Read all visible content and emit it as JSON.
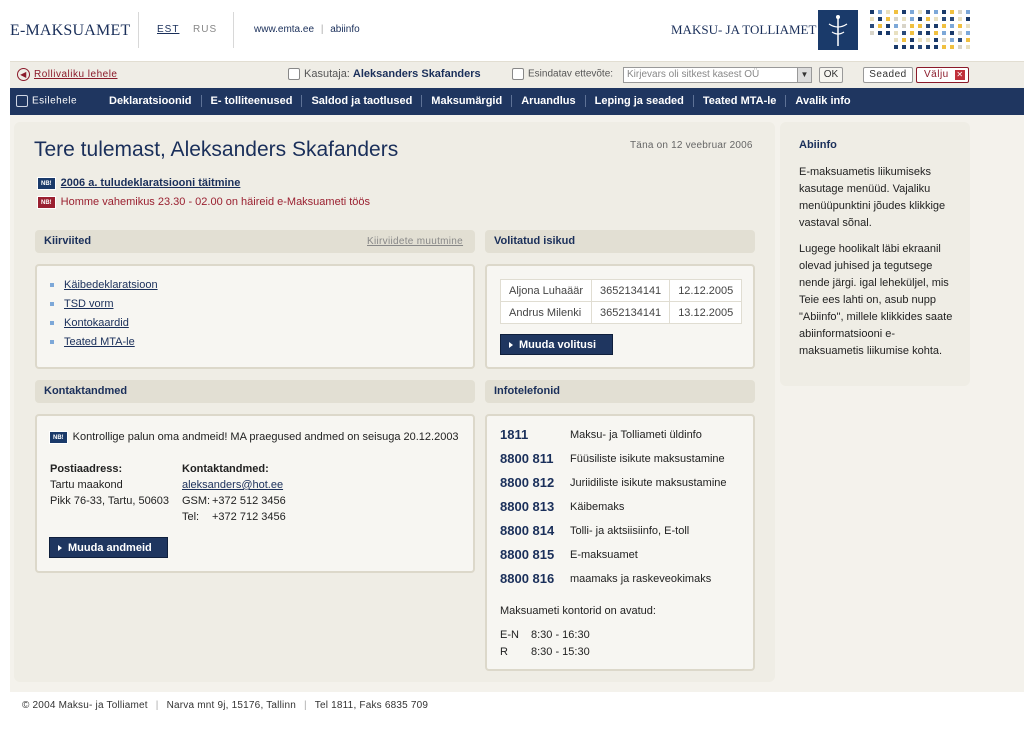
{
  "header": {
    "logo_left": "E-MAKSUAMET",
    "lang_est": "EST",
    "lang_rus": "RUS",
    "link_site": "www.emta.ee",
    "link_sep": "|",
    "link_help": "abiinfo",
    "logo_right": "MAKSU- JA TOLLIAMET"
  },
  "toolbar": {
    "back_label": "Rollivaliku lehele",
    "user_label": "Kasutaja:",
    "user_name": "Aleksanders Skafanders",
    "firm_label": "Esindatav ettevõte:",
    "firm_placeholder": "Kirjevars oli sitkest kasest OÜ",
    "ok_label": "OK",
    "settings_label": "Seaded",
    "logout_label": "Välju"
  },
  "nav": {
    "home": "Esilehele",
    "items": [
      "Deklaratsioonid",
      "E- tolliteenused",
      "Saldod ja taotlused",
      "Maksumärgid",
      "Aruandlus",
      "Leping ja seaded",
      "Teated MTA-le",
      "Avalik info"
    ]
  },
  "main": {
    "welcome": "Tere tulemast, Aleksanders Skafanders",
    "today": "Täna on 12 veebruar 2006",
    "nb": "NB!",
    "notice1": "2006 a. tuludeklaratsiooni täitmine",
    "notice2": "Homme vahemikus 23.30 - 02.00 on häireid e-Maksuameti töös"
  },
  "quicklinks": {
    "title": "Kiirviited",
    "change": "Kiirviidete muutmine",
    "items": [
      "Käibedeklaratsioon",
      "TSD vorm",
      "Kontokaardid",
      "Teated MTA-le"
    ]
  },
  "authorized": {
    "title": "Volitatud isikud",
    "rows": [
      [
        "Aljona Luhaäär",
        "3652134141",
        "12.12.2005"
      ],
      [
        "Andrus Milenki",
        "3652134141",
        "13.12.2005"
      ]
    ],
    "button": "Muuda volitusi"
  },
  "contact": {
    "title": "Kontaktandmed",
    "notice": "Kontrollige palun oma andmeid! MA praegused andmed on seisuga 20.12.2003",
    "postal_label": "Postiaadress:",
    "postal_line1": "Tartu maakond",
    "postal_line2": "Pikk 76-33, Tartu, 50603",
    "contacts_label": "Kontaktandmed:",
    "email": "aleksanders@hot.ee",
    "gsm_label": "GSM:",
    "gsm": "+372 512 3456",
    "tel_label": "Tel:",
    "tel": "+372 712 3456",
    "button": "Muuda andmeid"
  },
  "infophone": {
    "title": "Infotelefonid",
    "rows": [
      {
        "num": "1811",
        "desc": "Maksu- ja Tolliameti üldinfo"
      },
      {
        "num": "8800 811",
        "desc": "Füüsiliste isikute maksustamine"
      },
      {
        "num": "8800 812",
        "desc": "Juriidiliste isikute maksustamine"
      },
      {
        "num": "8800 813",
        "desc": "Käibemaks"
      },
      {
        "num": "8800 814",
        "desc": "Tolli- ja aktsiisiinfo, E-toll"
      },
      {
        "num": "8800 815",
        "desc": "E-maksuamet"
      },
      {
        "num": "8800 816",
        "desc": "maamaks ja raskeveokimaks"
      }
    ],
    "hours_title": "Maksuameti kontorid on avatud:",
    "hours": [
      {
        "day": "E-N",
        "time": "8:30 - 16:30"
      },
      {
        "day": "R",
        "time": "8:30 - 15:30"
      }
    ]
  },
  "side": {
    "title": "Abiinfo",
    "p1": "E-maksuametis liikumiseks kasutage menüüd. Vajaliku menüüpunktini jõudes klikkige vastaval sõnal.",
    "p2": "Lugege hoolikalt läbi ekraanil olevad juhised ja tegutsege nende järgi. igal leheküljel, mis Teie ees lahti on, asub nupp \"Abiinfo\", millele klikkides saate abiinformatsiooni e-maksuametis liikumise kohta."
  },
  "footer": {
    "copyright": "© 2004 Maksu- ja Tolliamet",
    "address": "Narva mnt 9j, 15176, Tallinn",
    "phone": "Tel 1811, Faks 6835 709",
    "sep": "|"
  }
}
